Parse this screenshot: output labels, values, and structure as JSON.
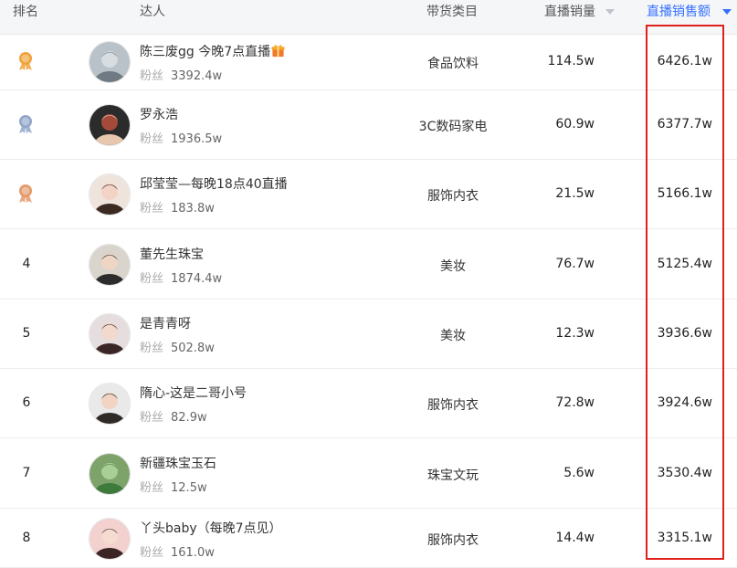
{
  "header": {
    "rank": "排名",
    "talent": "达人",
    "category": "带货类目",
    "live_volume": "直播销量",
    "live_sales": "直播销售额"
  },
  "rows": [
    {
      "rank": "1",
      "rank_icon": "gold-medal-icon",
      "name": "陈三废gg 今晚7点直播",
      "has_gift_icon": true,
      "fans_label": "粉丝",
      "fans": "3392.4w",
      "category": "食品饮料",
      "volume": "114.5w",
      "sales": "6426.1w"
    },
    {
      "rank": "2",
      "rank_icon": "silver-medal-icon",
      "name": "罗永浩",
      "fans_label": "粉丝",
      "fans": "1936.5w",
      "category": "3C数码家电",
      "volume": "60.9w",
      "sales": "6377.7w"
    },
    {
      "rank": "3",
      "rank_icon": "bronze-medal-icon",
      "name": "邱莹莹—每晚18点40直播",
      "fans_label": "粉丝",
      "fans": "183.8w",
      "category": "服饰内衣",
      "volume": "21.5w",
      "sales": "5166.1w"
    },
    {
      "rank": "4",
      "name": "董先生珠宝",
      "fans_label": "粉丝",
      "fans": "1874.4w",
      "category": "美妆",
      "volume": "76.7w",
      "sales": "5125.4w"
    },
    {
      "rank": "5",
      "name": "是青青呀",
      "fans_label": "粉丝",
      "fans": "502.8w",
      "category": "美妆",
      "volume": "12.3w",
      "sales": "3936.6w"
    },
    {
      "rank": "6",
      "name": "隋心-这是二哥小号",
      "fans_label": "粉丝",
      "fans": "82.9w",
      "category": "服饰内衣",
      "volume": "72.8w",
      "sales": "3924.6w"
    },
    {
      "rank": "7",
      "name": "新疆珠宝玉石",
      "fans_label": "粉丝",
      "fans": "12.5w",
      "category": "珠宝文玩",
      "volume": "5.6w",
      "sales": "3530.4w"
    },
    {
      "rank": "8",
      "name": "丫头baby（每晚7点见）",
      "fans_label": "粉丝",
      "fans": "161.0w",
      "category": "服饰内衣",
      "volume": "14.4w",
      "sales": "3315.1w"
    }
  ],
  "colors": {
    "accent": "#3370ff",
    "highlight_border": "#e0201c",
    "gold": "#f0a23a",
    "silver": "#8fa6c9",
    "bronze": "#e39a6a"
  }
}
